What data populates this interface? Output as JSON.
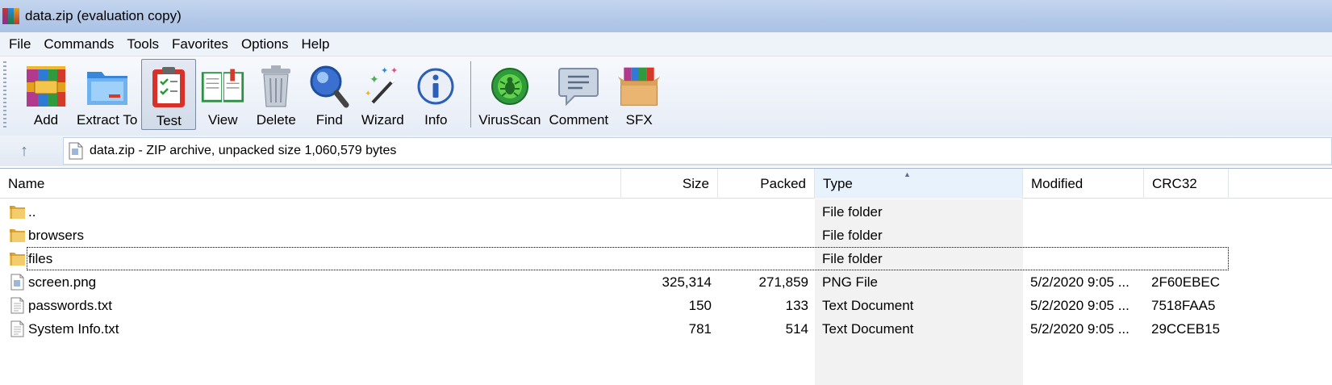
{
  "window": {
    "title": "data.zip (evaluation copy)"
  },
  "menu": [
    "File",
    "Commands",
    "Tools",
    "Favorites",
    "Options",
    "Help"
  ],
  "toolbar": {
    "buttons": [
      {
        "label": "Add",
        "icon": "add-archive-icon"
      },
      {
        "label": "Extract To",
        "icon": "extract-folder-icon"
      },
      {
        "label": "Test",
        "icon": "test-clipboard-icon",
        "active": true
      },
      {
        "label": "View",
        "icon": "view-book-icon"
      },
      {
        "label": "Delete",
        "icon": "trash-can-icon"
      },
      {
        "label": "Find",
        "icon": "magnifier-icon"
      },
      {
        "label": "Wizard",
        "icon": "magic-wand-icon"
      },
      {
        "label": "Info",
        "icon": "info-icon"
      },
      {
        "label": "VirusScan",
        "icon": "virus-scan-icon"
      },
      {
        "label": "Comment",
        "icon": "comment-bubble-icon"
      },
      {
        "label": "SFX",
        "icon": "sfx-box-icon"
      }
    ]
  },
  "address": {
    "text": "data.zip - ZIP archive, unpacked size 1,060,579 bytes"
  },
  "columns": {
    "name": "Name",
    "size": "Size",
    "packed": "Packed",
    "type": "Type",
    "modified": "Modified",
    "crc": "CRC32"
  },
  "files": [
    {
      "name": "..",
      "size": "",
      "packed": "",
      "type": "File folder",
      "modified": "",
      "crc": "",
      "icon": "folder-icon"
    },
    {
      "name": "browsers",
      "size": "",
      "packed": "",
      "type": "File folder",
      "modified": "",
      "crc": "",
      "icon": "folder-icon"
    },
    {
      "name": "files",
      "size": "",
      "packed": "",
      "type": "File folder",
      "modified": "",
      "crc": "",
      "icon": "folder-icon",
      "focused": true
    },
    {
      "name": "screen.png",
      "size": "325,314",
      "packed": "271,859",
      "type": "PNG File",
      "modified": "5/2/2020 9:05 ...",
      "crc": "2F60EBEC",
      "icon": "image-file-icon"
    },
    {
      "name": "passwords.txt",
      "size": "150",
      "packed": "133",
      "type": "Text Document",
      "modified": "5/2/2020 9:05 ...",
      "crc": "7518FAA5",
      "icon": "text-file-icon"
    },
    {
      "name": "System Info.txt",
      "size": "781",
      "packed": "514",
      "type": "Text Document",
      "modified": "5/2/2020 9:05 ...",
      "crc": "29CCEB15",
      "icon": "text-file-icon"
    }
  ]
}
